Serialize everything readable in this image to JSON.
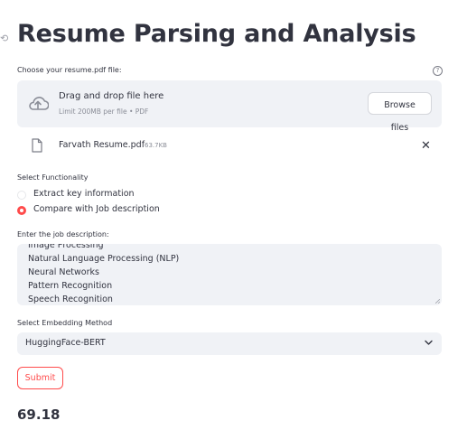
{
  "page": {
    "anchor_glyph": "⟲",
    "title": "Resume Parsing and Analysis"
  },
  "uploader": {
    "label": "Choose your resume.pdf file:",
    "help_icon": "?",
    "drop_title": "Drag and drop file here",
    "drop_subtitle": "Limit 200MB per file • PDF",
    "browse_label": "Browse files",
    "icon": "cloud-upload-icon"
  },
  "uploaded_file": {
    "name": "Farvath Resume.pdf",
    "size": "63.7KB",
    "remove_glyph": "✕",
    "icon": "file-icon"
  },
  "functionality": {
    "label": "Select Functionality",
    "options": [
      {
        "label": "Extract key information",
        "selected": false
      },
      {
        "label": "Compare with Job description",
        "selected": true
      }
    ]
  },
  "job_description": {
    "label": "Enter the job description:",
    "lines": [
      "Image Processing",
      "Natural Language Processing (NLP)",
      "Neural Networks",
      "Pattern Recognition",
      "Speech Recognition"
    ]
  },
  "embedding": {
    "label": "Select Embedding Method",
    "selected": "HuggingFace-BERT"
  },
  "submit": {
    "label": "Submit"
  },
  "result": {
    "score": "69.18"
  },
  "colors": {
    "accent": "#ff4b4b",
    "input_bg": "#f0f2f6",
    "text": "#31333f"
  }
}
